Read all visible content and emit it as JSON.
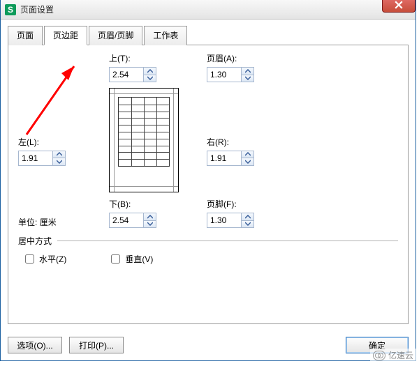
{
  "window": {
    "app_icon_letter": "S",
    "title": "页面设置"
  },
  "tabs": [
    {
      "label": "页面"
    },
    {
      "label": "页边距"
    },
    {
      "label": "页眉/页脚"
    },
    {
      "label": "工作表"
    }
  ],
  "margins": {
    "top": {
      "label": "上(T):",
      "value": "2.54"
    },
    "header": {
      "label": "页眉(A):",
      "value": "1.30"
    },
    "left": {
      "label": "左(L):",
      "value": "1.91"
    },
    "right": {
      "label": "右(R):",
      "value": "1.91"
    },
    "bottom": {
      "label": "下(B):",
      "value": "2.54"
    },
    "footer": {
      "label": "页脚(F):",
      "value": "1.30"
    }
  },
  "unit": {
    "label": "单位:",
    "value": "厘米"
  },
  "center": {
    "legend": "居中方式",
    "horizontal": {
      "label": "水平(Z)",
      "checked": false
    },
    "vertical": {
      "label": "垂直(V)",
      "checked": false
    }
  },
  "buttons": {
    "options": "选项(O)...",
    "print": "打印(P)...",
    "ok": "确定"
  },
  "watermark": "亿速云",
  "colors": {
    "accent": "#0e9b5a",
    "close_red": "#c74d3a",
    "arrow_red": "#ff0000"
  }
}
